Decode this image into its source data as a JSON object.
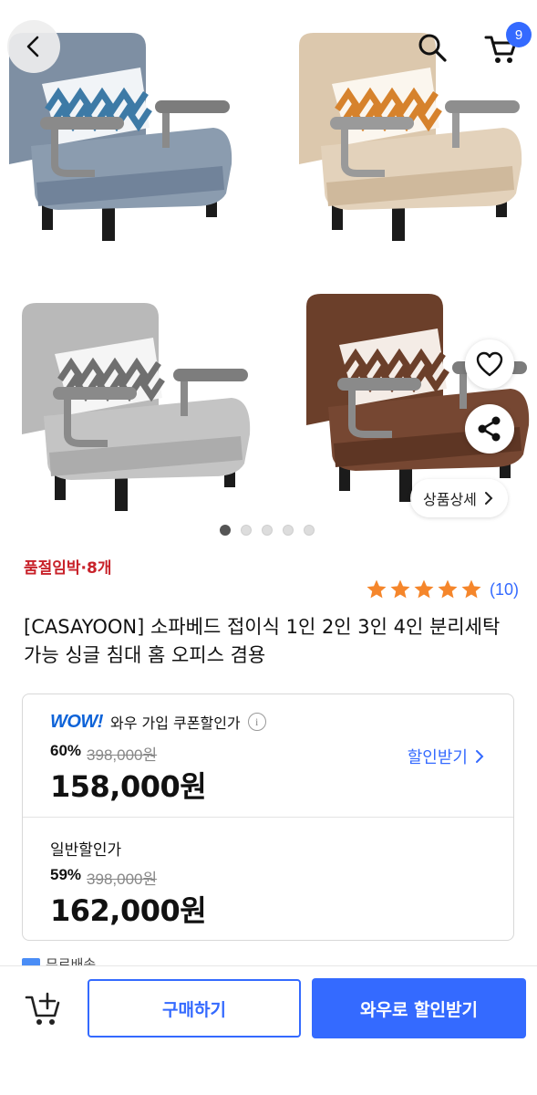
{
  "header": {
    "cart_count": "9"
  },
  "gallery": {
    "detail_button_label": "상품상세",
    "page_count": 5,
    "active_page": 1,
    "chair_colors": {
      "blue_gray": "#7e8fa3",
      "beige": "#dcc8ad",
      "light_gray": "#b9b9b9",
      "brown": "#6b3f2a"
    }
  },
  "product": {
    "stock_notice": "품절임박·8개",
    "rating_stars": 5,
    "review_count": "(10)",
    "title": "[CASAYOON] 소파베드 접이식 1인 2인 3인 4인 분리세탁 가능 싱글 침대 홈 오피스 겸용"
  },
  "pricing": {
    "wow_logo": "WOW!",
    "wow_label": "와우 가입 쿠폰할인가",
    "wow_discount_pct": "60%",
    "wow_original_price": "398,000원",
    "wow_price": "158,000원",
    "discount_link_label": "할인받기",
    "normal_label": "일반할인가",
    "normal_discount_pct": "59%",
    "normal_original_price": "398,000원",
    "normal_price": "162,000원"
  },
  "peek_text": "무료배송",
  "bottom_bar": {
    "buy_label": "구매하기",
    "wow_label": "와우로 할인받기"
  },
  "colors": {
    "accent": "#346aff",
    "stock_red": "#c8222a",
    "star_orange": "#f5862b"
  }
}
